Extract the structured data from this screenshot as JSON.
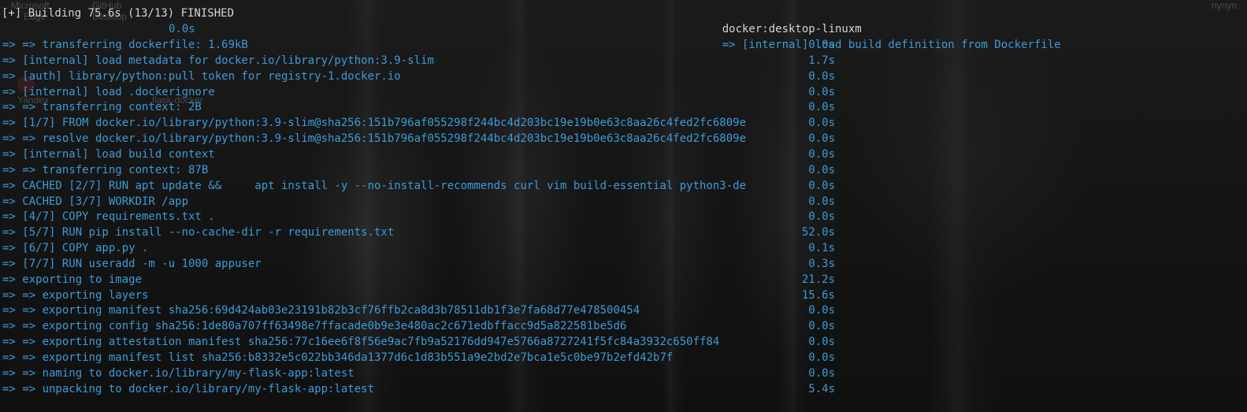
{
  "background": {
    "desktop_labels": [
      "Microsoft",
      "Edge",
      "GitHub",
      "Desktop",
      "Yandex",
      "flask-docker",
      "nynyn"
    ]
  },
  "terminal": {
    "header": {
      "status": "[+] Building 75.6s (13/13) FINISHED",
      "context": "docker:desktop-linuxm",
      "first_step": "=> [internal] load build definition from Dockerfile",
      "first_step_duration": "0.0s"
    },
    "steps": [
      {
        "text": "=> => transferring dockerfile: 1.69kB",
        "duration": "0.0s"
      },
      {
        "text": "=> [internal] load metadata for docker.io/library/python:3.9-slim",
        "duration": "1.7s"
      },
      {
        "text": "=> [auth] library/python:pull token for registry-1.docker.io",
        "duration": "0.0s"
      },
      {
        "text": "=> [internal] load .dockerignore",
        "duration": "0.0s"
      },
      {
        "text": "=> => transferring context: 2B",
        "duration": "0.0s"
      },
      {
        "text": "=> [1/7] FROM docker.io/library/python:3.9-slim@sha256:151b796af055298f244bc4d203bc19e19b0e63c8aa26c4fed2fc6809e",
        "duration": "0.0s"
      },
      {
        "text": "=> => resolve docker.io/library/python:3.9-slim@sha256:151b796af055298f244bc4d203bc19e19b0e63c8aa26c4fed2fc6809e",
        "duration": "0.0s"
      },
      {
        "text": "=> [internal] load build context",
        "duration": "0.0s"
      },
      {
        "text": "=> => transferring context: 87B",
        "duration": "0.0s"
      },
      {
        "text": "=> CACHED [2/7] RUN apt update &&     apt install -y --no-install-recommends curl vim build-essential python3-de",
        "duration": "0.0s"
      },
      {
        "text": "=> CACHED [3/7] WORKDIR /app",
        "duration": "0.0s"
      },
      {
        "text": "=> [4/7] COPY requirements.txt .",
        "duration": "0.0s"
      },
      {
        "text": "=> [5/7] RUN pip install --no-cache-dir -r requirements.txt",
        "duration": "52.0s"
      },
      {
        "text": "=> [6/7] COPY app.py .",
        "duration": "0.1s"
      },
      {
        "text": "=> [7/7] RUN useradd -m -u 1000 appuser",
        "duration": "0.3s"
      },
      {
        "text": "=> exporting to image",
        "duration": "21.2s"
      },
      {
        "text": "=> => exporting layers",
        "duration": "15.6s"
      },
      {
        "text": "=> => exporting manifest sha256:69d424ab03e23191b82b3cf76ffb2ca8d3b78511db1f3e7fa68d77e478500454",
        "duration": "0.0s"
      },
      {
        "text": "=> => exporting config sha256:1de80a707ff63498e7ffacade0b9e3e480ac2c671edbffacc9d5a822581be5d6",
        "duration": "0.0s"
      },
      {
        "text": "=> => exporting attestation manifest sha256:77c16ee6f8f56e9ac7fb9a52176dd947e5766a8727241f5fc84a3932c650ff84",
        "duration": "0.0s"
      },
      {
        "text": "=> => exporting manifest list sha256:b8332e5c022bb346da1377d6c1d83b551a9e2bd2e7bca1e5c0be97b2efd42b7f",
        "duration": "0.0s"
      },
      {
        "text": "=> => naming to docker.io/library/my-flask-app:latest",
        "duration": "0.0s"
      },
      {
        "text": "=> => unpacking to docker.io/library/my-flask-app:latest",
        "duration": "5.4s"
      }
    ]
  },
  "colors": {
    "text_primary": "#d4d4d4",
    "text_step": "#3b9bd8",
    "background": "#151515"
  }
}
